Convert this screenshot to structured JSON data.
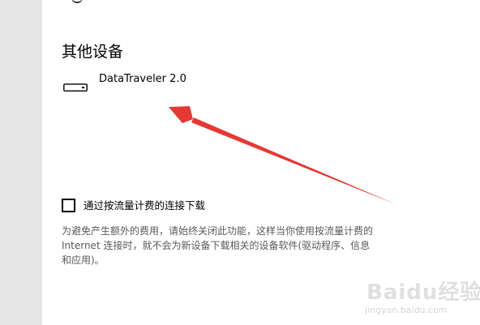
{
  "section": {
    "title": "其他设备"
  },
  "device": {
    "name": "DataTraveler 2.0",
    "icon": "usb-drive-icon"
  },
  "metered": {
    "label": "通过按流量计费的连接下载",
    "checked": false,
    "description_lines": [
      "为避免产生额外的费用，请始终关闭此功能，这样当你使用按流量计费的",
      "Internet 连接时，就不会为新设备下载相关的设备软件(驱动程序、信息",
      "和应用)。"
    ]
  },
  "annotation": {
    "arrow_color": "#e53935"
  },
  "watermark": {
    "brand": "Baidu经验",
    "url": "jingyan.baidu.com"
  },
  "colors": {
    "sidebar": "#e6e6e6",
    "description_text": "#5a5a5a"
  }
}
